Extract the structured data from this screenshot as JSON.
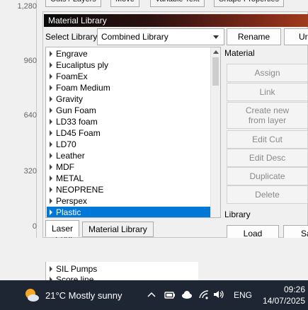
{
  "ruler": {
    "ticks": [
      "1,280",
      "960",
      "640",
      "320",
      "0"
    ]
  },
  "top_tabs": [
    "Cuts / Layers",
    "Move",
    "Variable Text",
    "Shape Properties"
  ],
  "window": {
    "title": "Material Library"
  },
  "library": {
    "select_label": "Select Library",
    "selected": "Combined Library",
    "rename_label": "Rename",
    "clipped_button_label": "Ur"
  },
  "materials": [
    "Engrave",
    "Eucaliptus ply",
    "FoamEx",
    "Foam Medium",
    "Gravity",
    "Gun Foam",
    "LD33 foam",
    "LD45 Foam",
    "LD70",
    "Leather",
    "MDF",
    "METAL",
    "NEOPRENE",
    "Perspex",
    "Plastic"
  ],
  "selected_material": "Plastic",
  "material_section": {
    "label": "Material",
    "buttons": {
      "assign": "Assign",
      "link": "Link",
      "create_line1": "Create new",
      "create_line2": "from layer",
      "edit_cut": "Edit Cut",
      "edit_desc": "Edit Desc",
      "duplicate": "Duplicate",
      "delete": "Delete"
    }
  },
  "library_section": {
    "label": "Library",
    "load": "Load",
    "clipped_save": "Sa"
  },
  "bottom_tabs": [
    "Laser",
    "Material Library"
  ],
  "peek_list": {
    "items": [
      "SIL Pumps",
      "Score line"
    ],
    "cut_top": "Podi..."
  },
  "taskbar": {
    "weather": "21°C  Mostly sunny",
    "lang": "ENG",
    "time": "09:26",
    "date": "14/07/2025"
  }
}
